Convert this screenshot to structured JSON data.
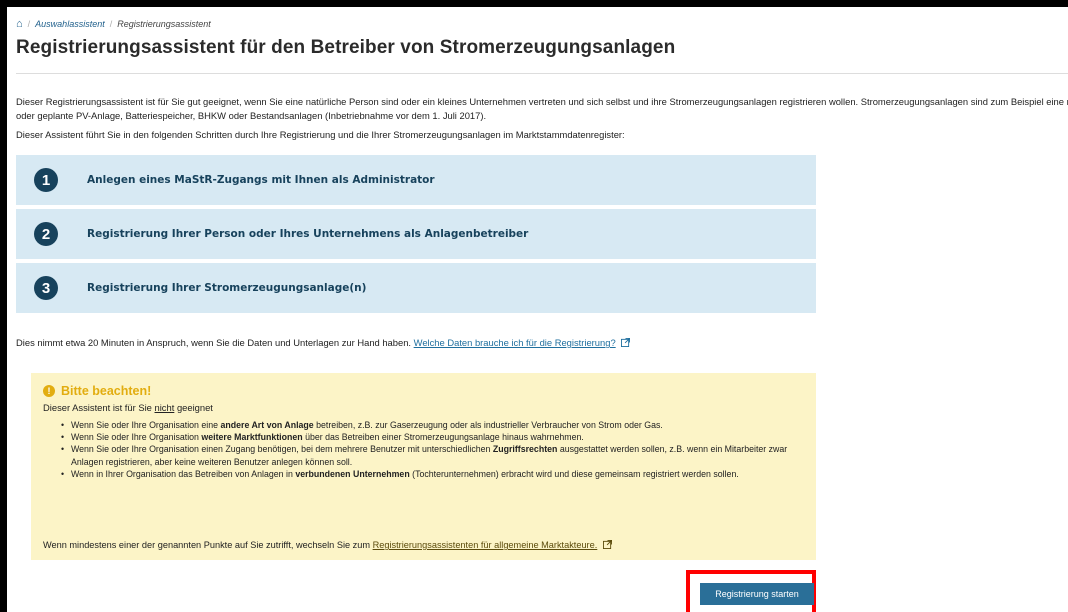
{
  "breadcrumb": {
    "items": [
      "Auswahlassistent",
      "Registrierungsassistent"
    ]
  },
  "page_title": "Registrierungsassistent für den Betreiber von Stromerzeugungsanlagen",
  "intro": {
    "p1": "Dieser Registrierungsassistent ist für Sie gut geeignet, wenn Sie eine natürliche Person sind oder ein kleines Unternehmen vertreten und sich selbst und ihre Stromerzeugungsanlagen registrieren wollen. Stromerzeugungsanlagen sind zum Beispiel eine neue oder geplante PV-Anlage, Batteriespeicher, BHKW oder Bestandsanlagen (Inbetriebnahme vor dem 1. Juli 2017).",
    "p2": "Dieser Assistent führt Sie in den folgenden Schritten durch Ihre Registrierung und die Ihrer Stromerzeugungsanlagen im Marktstammdatenregister:"
  },
  "steps": [
    {
      "number": "1",
      "label": "Anlegen eines MaStR-Zugangs mit Ihnen als Administrator"
    },
    {
      "number": "2",
      "label": "Registrierung Ihrer Person oder Ihres Unternehmens als Anlagenbetreiber"
    },
    {
      "number": "3",
      "label": "Registrierung Ihrer Stromerzeugungsanlage(n)"
    }
  ],
  "duration": {
    "text": "Dies nimmt etwa 20 Minuten in Anspruch, wenn Sie die Daten und Unterlagen zur Hand haben.",
    "link": "Welche Daten brauche ich für die Registrierung?"
  },
  "notice": {
    "title": "Bitte beachten!",
    "sub_prefix": "Dieser Assistent ist für Sie",
    "sub_emph": "nicht",
    "sub_suffix": "geeignet",
    "items": [
      {
        "a": "Wenn Sie oder Ihre Organisation eine",
        "b": "andere Art von Anlage",
        "c": "betreiben, z.B. zur Gaserzeugung oder als industrieller Verbraucher von Strom oder Gas."
      },
      {
        "a": "Wenn Sie oder Ihre Organisation",
        "b": "weitere Marktfunktionen",
        "c": "über das Betreiben einer Stromerzeugungsanlage hinaus wahrnehmen."
      },
      {
        "a": "Wenn Sie oder Ihre Organisation einen Zugang benötigen, bei dem mehrere Benutzer mit unterschiedlichen",
        "b": "Zugriffsrechten",
        "c": "ausgestattet werden sollen, z.B. wenn ein Mitarbeiter zwar Anlagen registrieren, aber keine weiteren Benutzer anlegen können soll."
      },
      {
        "a": "Wenn in Ihrer Organisation das Betreiben von Anlagen in",
        "b": "verbundenen Unternehmen",
        "c": "(Tochterunternehmen) erbracht wird und diese gemeinsam registriert werden sollen."
      }
    ],
    "switch_text": "Wenn mindestens einer der genannten Punkte auf Sie zutrifft, wechseln Sie zum",
    "switch_link": "Registrierungsassistenten für allgemeine Marktakteure."
  },
  "start_button": "Registrierung starten",
  "colors": {
    "step_bg": "#d7e9f3",
    "step_accent": "#17425c",
    "notice_bg": "#fcf4c7",
    "warning": "#e2ad10",
    "button": "#2a6f98",
    "highlight": "#ff0000"
  }
}
